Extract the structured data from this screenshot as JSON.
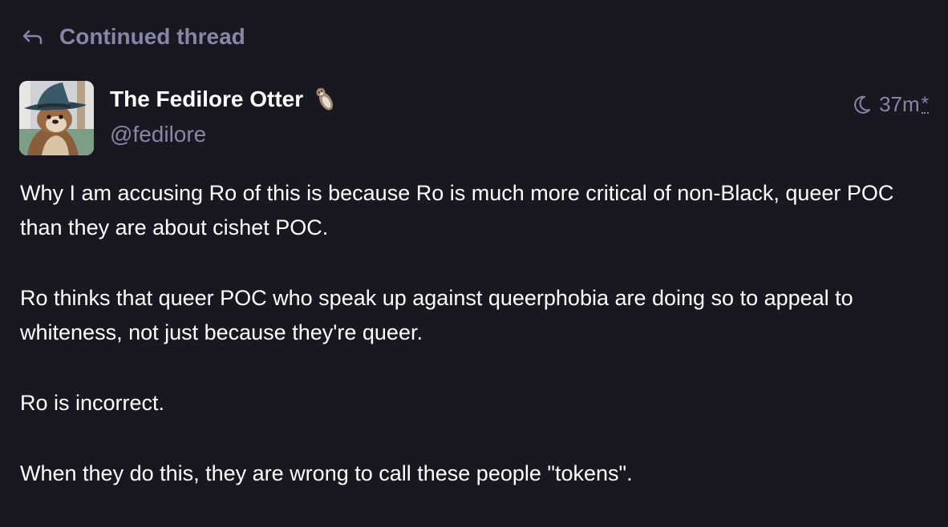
{
  "thread": {
    "label": "Continued thread"
  },
  "author": {
    "display_name": "The Fedilore Otter",
    "handle": "@fedilore",
    "emoji": "otter-emoji"
  },
  "post": {
    "time": "37m",
    "edited_marker": "*",
    "visibility_icon": "moon-icon",
    "paragraphs": [
      "Why I am accusing Ro of this is because Ro is much more critical of non-Black, queer POC than they are about cishet POC.",
      "Ro thinks that queer POC who speak up against queerphobia are doing so to appeal to whiteness, not just because they're queer.",
      "Ro is incorrect.",
      "When they do this, they are wrong to call these people \"tokens\"."
    ]
  },
  "colors": {
    "background": "#191820",
    "muted": "#8886a8",
    "text": "#ffffff"
  }
}
